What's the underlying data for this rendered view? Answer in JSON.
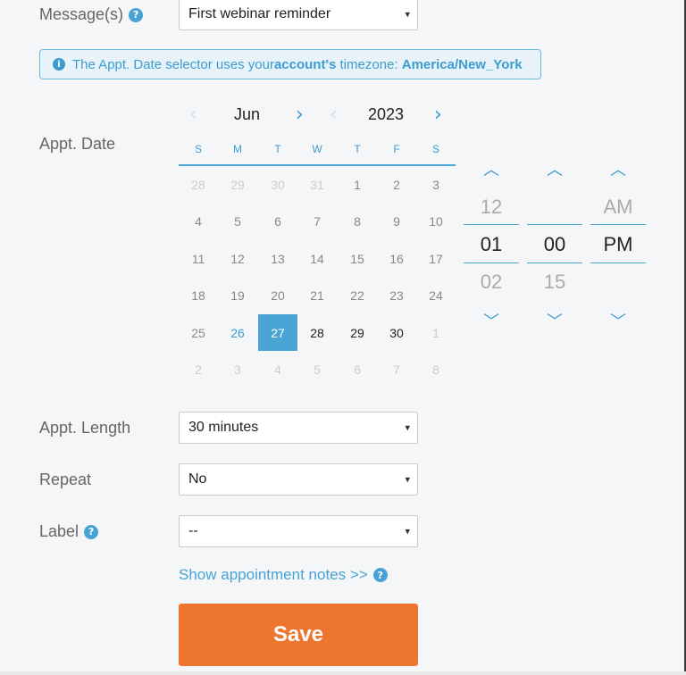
{
  "message": {
    "label": "Message(s)",
    "help": "?",
    "value": "First webinar reminder"
  },
  "info": {
    "icon": "info-icon",
    "prefix": "The Appt. Date selector uses your ",
    "account": "account's",
    "middle": " timezone: ",
    "timezone": "America/New_York"
  },
  "appt_date": {
    "label": "Appt. Date",
    "month": "Jun",
    "year": "2023",
    "prev_icon": "‹",
    "next_icon": "›",
    "weekdays": [
      "S",
      "M",
      "T",
      "W",
      "T",
      "F",
      "S"
    ],
    "weeks": [
      [
        "28",
        "29",
        "30",
        "31",
        "1",
        "2",
        "3"
      ],
      [
        "4",
        "5",
        "6",
        "7",
        "8",
        "9",
        "10"
      ],
      [
        "11",
        "12",
        "13",
        "14",
        "15",
        "16",
        "17"
      ],
      [
        "18",
        "19",
        "20",
        "21",
        "22",
        "23",
        "24"
      ],
      [
        "25",
        "26",
        "27",
        "28",
        "29",
        "30",
        "1"
      ],
      [
        "2",
        "3",
        "4",
        "5",
        "6",
        "7",
        "8"
      ]
    ],
    "selected": "27",
    "today": "26"
  },
  "time": {
    "hour_prev": "12",
    "hour": "01",
    "hour_next": "02",
    "minute": "00",
    "minute_next": "15",
    "ampm_prev": "AM",
    "ampm": "PM"
  },
  "appt_length": {
    "label": "Appt. Length",
    "value": "30 minutes"
  },
  "repeat": {
    "label": "Repeat",
    "value": "No"
  },
  "label_field": {
    "label": "Label",
    "help": "?",
    "value": "--"
  },
  "notes_link": {
    "text": "Show appointment notes >>",
    "help": "?"
  },
  "save": {
    "label": "Save"
  },
  "colors": {
    "accent": "#47a2d6",
    "save": "#ee7530",
    "info_bg": "#e7f3f9"
  }
}
